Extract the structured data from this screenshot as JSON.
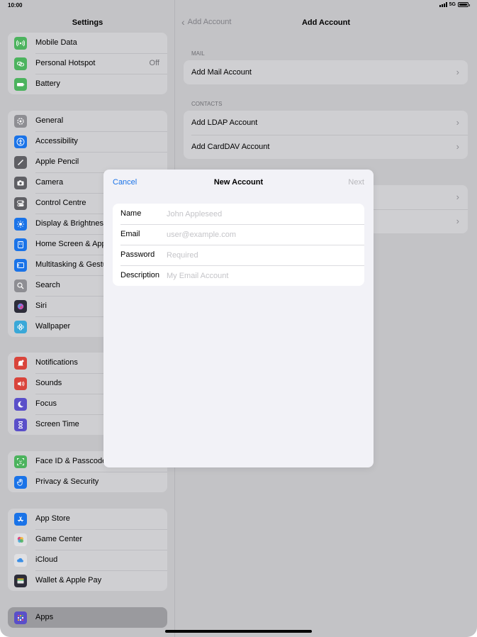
{
  "status": {
    "time": "10:00",
    "network": "5G"
  },
  "sidebar": {
    "title": "Settings",
    "groups": [
      {
        "items": [
          {
            "label": "Mobile Data",
            "icon": "antenna-icon",
            "color": "#4cb35e"
          },
          {
            "label": "Personal Hotspot",
            "value": "Off",
            "icon": "link-icon",
            "color": "#4cb35e"
          },
          {
            "label": "Battery",
            "icon": "battery-icon",
            "color": "#4cb35e"
          }
        ]
      },
      {
        "items": [
          {
            "label": "General",
            "icon": "gear-icon",
            "color": "#8e8e93"
          },
          {
            "label": "Accessibility",
            "icon": "accessibility-icon",
            "color": "#1a73e8"
          },
          {
            "label": "Apple Pencil",
            "icon": "pencil-icon",
            "color": "#5f5f64"
          },
          {
            "label": "Camera",
            "icon": "camera-icon",
            "color": "#5f5f64"
          },
          {
            "label": "Control Centre",
            "icon": "switches-icon",
            "color": "#5f5f64"
          },
          {
            "label": "Display & Brightness",
            "icon": "sun-icon",
            "color": "#1a73e8"
          },
          {
            "label": "Home Screen & App Library",
            "icon": "home-screen-icon",
            "color": "#1a73e8"
          },
          {
            "label": "Multitasking & Gestures",
            "icon": "multitasking-icon",
            "color": "#1a73e8"
          },
          {
            "label": "Search",
            "icon": "search-icon",
            "color": "#8e8e93"
          },
          {
            "label": "Siri",
            "icon": "siri-icon",
            "color": "#2d2d3a"
          },
          {
            "label": "Wallpaper",
            "icon": "flower-icon",
            "color": "#3aa8d8"
          }
        ]
      },
      {
        "items": [
          {
            "label": "Notifications",
            "icon": "bell-icon",
            "color": "#d9443b"
          },
          {
            "label": "Sounds",
            "icon": "speaker-icon",
            "color": "#d9443b"
          },
          {
            "label": "Focus",
            "icon": "moon-icon",
            "color": "#5a4fc9"
          },
          {
            "label": "Screen Time",
            "icon": "hourglass-icon",
            "color": "#5a4fc9"
          }
        ]
      },
      {
        "items": [
          {
            "label": "Face ID & Passcode",
            "icon": "face-id-icon",
            "color": "#4cb35e"
          },
          {
            "label": "Privacy & Security",
            "icon": "hand-icon",
            "color": "#1a73e8"
          }
        ]
      },
      {
        "items": [
          {
            "label": "App Store",
            "icon": "app-store-icon",
            "color": "#1a73e8"
          },
          {
            "label": "Game Center",
            "icon": "game-center-icon",
            "color": "#e0e0e3"
          },
          {
            "label": "iCloud",
            "icon": "cloud-icon",
            "color": "#e0e0e3"
          },
          {
            "label": "Wallet & Apple Pay",
            "icon": "wallet-icon",
            "color": "#2d2d3a"
          }
        ]
      },
      {
        "items": [
          {
            "label": "Apps",
            "icon": "apps-grid-icon",
            "color": "#5a4fc9",
            "selected": true
          }
        ]
      }
    ]
  },
  "detail": {
    "back_label": "Add Account",
    "title": "Add Account",
    "sections": [
      {
        "header": "MAIL",
        "rows": [
          "Add Mail Account"
        ]
      },
      {
        "header": "CONTACTS",
        "rows": [
          "Add LDAP Account",
          "Add CardDAV Account"
        ]
      },
      {
        "header": "",
        "rows": [
          "",
          ""
        ]
      }
    ]
  },
  "modal": {
    "cancel": "Cancel",
    "title": "New Account",
    "next": "Next",
    "fields": [
      {
        "label": "Name",
        "placeholder": "John Appleseed"
      },
      {
        "label": "Email",
        "placeholder": "user@example.com"
      },
      {
        "label": "Password",
        "placeholder": "Required"
      },
      {
        "label": "Description",
        "placeholder": "My Email Account"
      }
    ]
  }
}
